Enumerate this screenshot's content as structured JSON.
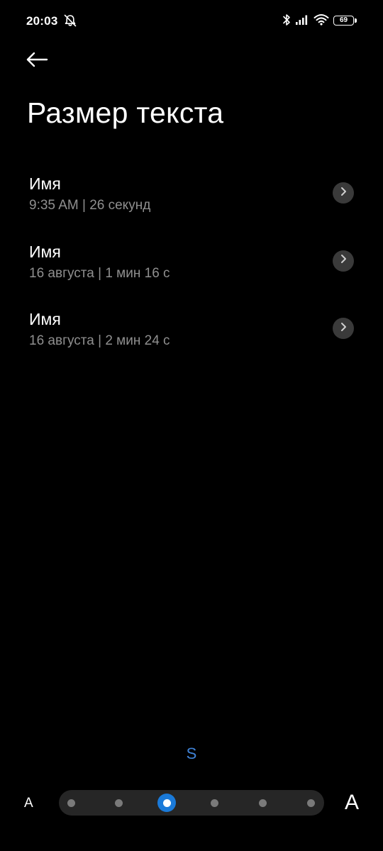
{
  "status_bar": {
    "time": "20:03",
    "battery": "69",
    "icons": [
      "bell-off-icon",
      "bluetooth-icon",
      "cellular-signal-icon",
      "wifi-icon",
      "battery-icon"
    ]
  },
  "header": {
    "back_icon": "arrow-left-icon",
    "title": "Размер текста"
  },
  "calls": [
    {
      "name": "Имя",
      "meta": "9:35 AM | 26 секунд"
    },
    {
      "name": "Имя",
      "meta": "16 августа | 1 мин 16 с"
    },
    {
      "name": "Имя",
      "meta": "16 августа | 2 мин 24 с"
    }
  ],
  "text_size": {
    "current_label": "S",
    "small_label": "A",
    "large_label": "A",
    "steps": 6,
    "selected_step": 3
  },
  "colors": {
    "background": "#000000",
    "accent": "#1a7ad9",
    "secondary_text": "#8f8f8f",
    "chevron_bg": "#3a3a3a"
  }
}
